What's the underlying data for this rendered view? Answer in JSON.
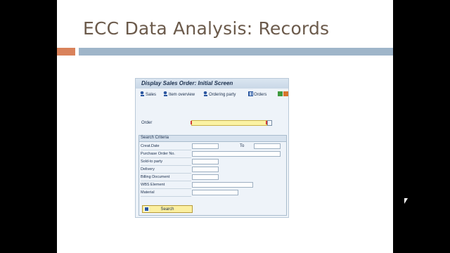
{
  "slide": {
    "title": "ECC Data Analysis:  Records",
    "accent_orange": "#d9825b",
    "accent_blue": "#9fb5c9"
  },
  "sap": {
    "title": "Display Sales Order: Initial Screen",
    "toolbar": [
      {
        "label": "Sales",
        "icon": "sales-icon"
      },
      {
        "label": "Item overview",
        "icon": "item-overview-icon"
      },
      {
        "label": "Ordering party",
        "icon": "ordering-party-icon"
      },
      {
        "label": "Orders",
        "icon": "orders-grid-icon"
      }
    ],
    "order_label": "Order",
    "order_value": "",
    "criteria": {
      "header": "Search Criteria",
      "to_label": "To",
      "fields": [
        {
          "label": "Creat.Date"
        },
        {
          "label": "Purchase Order No."
        },
        {
          "label": "Sold-to party"
        },
        {
          "label": "Delivery"
        },
        {
          "label": "Billing Document"
        },
        {
          "label": "WBS Element"
        },
        {
          "label": "Material"
        }
      ],
      "search_label": "Search"
    }
  }
}
